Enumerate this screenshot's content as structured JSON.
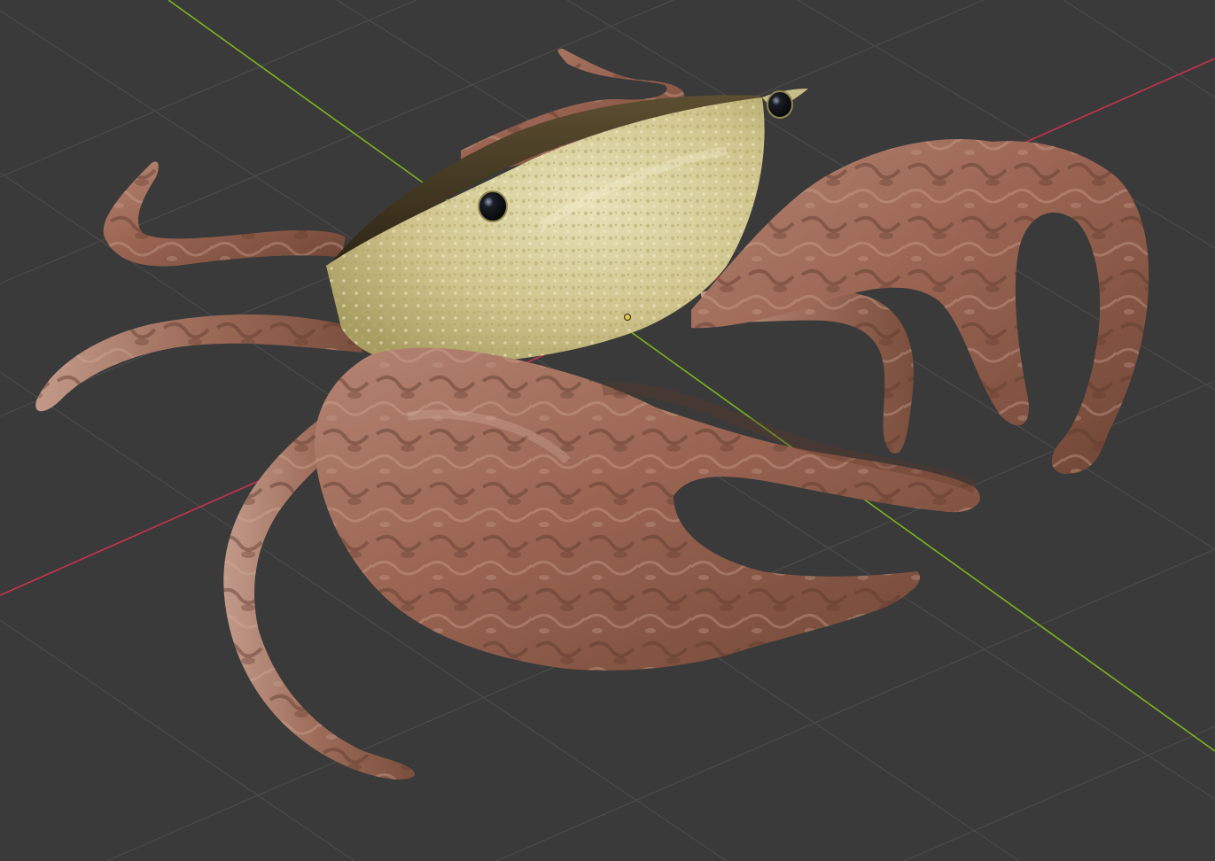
{
  "viewport": {
    "background_color": "#3a3a3a",
    "grid_color": "#4a4a4a",
    "x_axis_color": "#c8324e",
    "y_axis_color": "#7ab51d",
    "origin_marker_color": "#e6c640"
  },
  "crab_model": {
    "shell_color": "#d8cf9a",
    "shell_dark_color": "#4a4028",
    "limb_color": "#a06a55",
    "limb_dark_color": "#6e4535",
    "eye_color": "#0c0c10"
  }
}
